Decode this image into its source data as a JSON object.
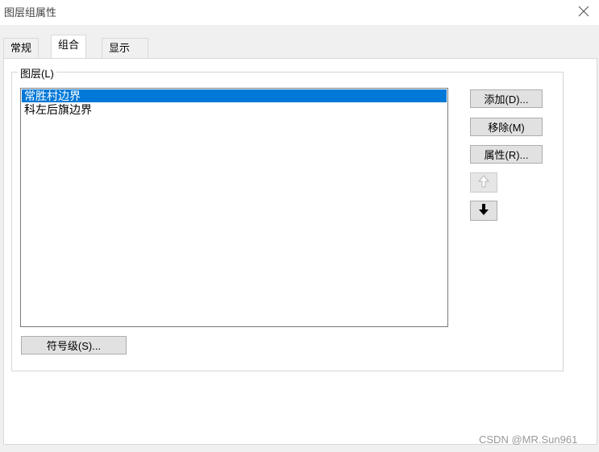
{
  "window": {
    "title": "图层组属性",
    "close_icon": "close-icon"
  },
  "tabs": [
    {
      "label": "常规",
      "active": false
    },
    {
      "label": "组合",
      "active": true
    },
    {
      "label": "显示",
      "active": false
    }
  ],
  "layers_group": {
    "legend": "图层(L)",
    "items": [
      {
        "label": "常胜村边界",
        "selected": true
      },
      {
        "label": "科左后旗边界",
        "selected": false
      }
    ]
  },
  "buttons": {
    "add": "添加(D)...",
    "remove": "移除(M)",
    "properties": "属性(R)...",
    "move_up_icon": "arrow-up-icon",
    "move_down_icon": "arrow-down-icon",
    "symbol_levels": "符号级(S)..."
  },
  "watermark": "CSDN @MR.Sun961",
  "colors": {
    "selection": "#0078d7",
    "window_bg": "#f0f0f0",
    "panel_bg": "#ffffff"
  }
}
